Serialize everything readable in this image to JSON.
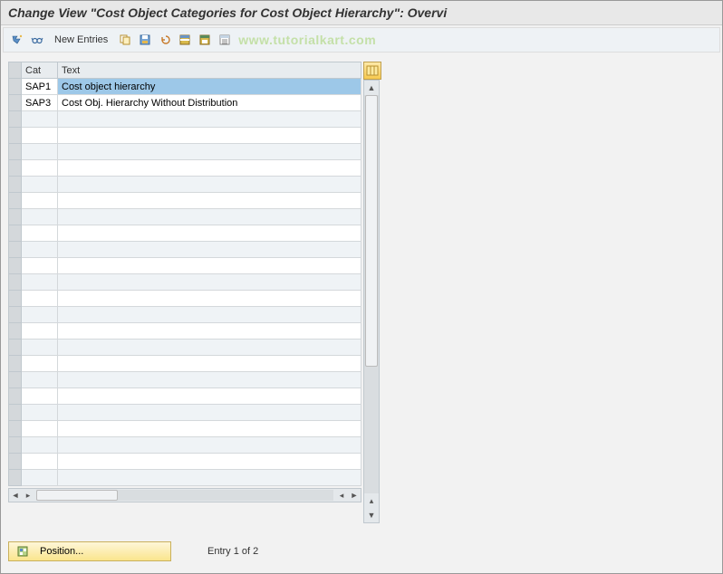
{
  "title": "Change View \"Cost Object Categories for Cost Object Hierarchy\": Overvi",
  "toolbar": {
    "new_entries_label": "New Entries",
    "icons": {
      "toggle": "toggle-icon",
      "glasses": "display-icon",
      "copy": "copy-icon",
      "save_var": "save-variant-icon",
      "undo": "undo-icon",
      "select_all": "select-all-icon",
      "save": "save-icon",
      "deselect": "deselect-icon"
    }
  },
  "watermark": "www.tutorialkart.com",
  "table": {
    "headers": {
      "cat": "Cat",
      "text": "Text"
    },
    "rows": [
      {
        "cat": "SAP1",
        "text": "Cost object hierarchy",
        "selected": true
      },
      {
        "cat": "SAP3",
        "text": "Cost Obj. Hierarchy Without Distribution",
        "selected": false
      }
    ],
    "empty_rows": 23
  },
  "footer": {
    "position_label": "Position...",
    "entry_text": "Entry 1 of 2"
  }
}
